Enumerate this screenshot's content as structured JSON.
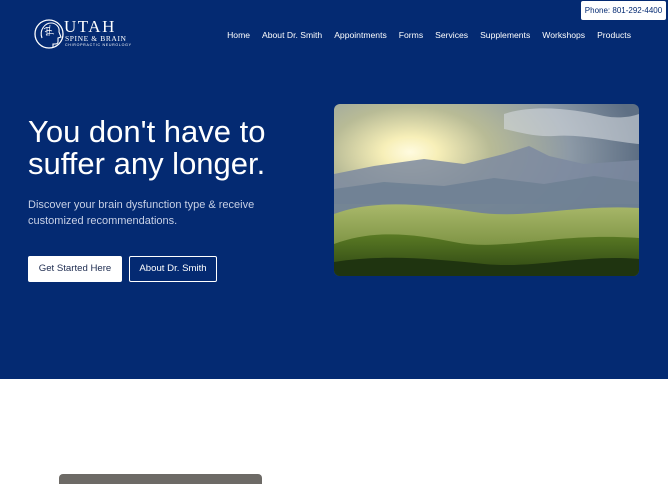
{
  "header": {
    "phone": "Phone: 801-292-4400",
    "logo": {
      "title": "UTAH",
      "subtitle": "SPINE & BRAIN",
      "tagline": "CHIROPRACTIC NEUROLOGY"
    },
    "nav": [
      "Home",
      "About Dr. Smith",
      "Appointments",
      "Forms",
      "Services",
      "Supplements",
      "Workshops",
      "Products"
    ]
  },
  "hero": {
    "headline_line1": "You don't have to",
    "headline_line2": "suffer any longer.",
    "subtext": "Discover your brain dysfunction type & receive customized recommendations.",
    "primary_button": "Get Started Here",
    "secondary_button": "About Dr. Smith",
    "image": "mountain-sunrise-landscape"
  },
  "colors": {
    "hero_background": "#042a72",
    "text_light": "#ffffff",
    "subtext": "#c7d0e6"
  }
}
